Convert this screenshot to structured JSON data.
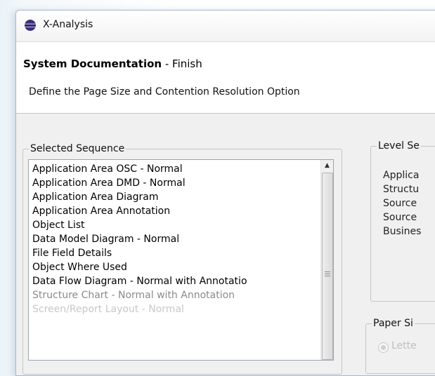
{
  "window": {
    "title": "X-Analysis"
  },
  "wizard": {
    "title_bold": "System Documentation",
    "title_rest": " - Finish",
    "description": "Define the Page Size and Contention Resolution Option"
  },
  "selected_sequence": {
    "label": "Selected Sequence",
    "items": [
      "Application Area OSC - Normal",
      "Application Area DMD - Normal",
      "Application Area Diagram",
      "Application Area Annotation",
      "Object List",
      "Data Model Diagram - Normal",
      "File Field Details",
      "Object Where Used",
      "Data Flow Diagram - Normal with Annotatio",
      "Structure Chart - Normal with Annotation",
      "Screen/Report Layout - Normal"
    ]
  },
  "level_settings": {
    "label": "Level Se",
    "items": [
      "Applica",
      "Structu",
      "Source",
      "Source",
      "Busines"
    ]
  },
  "paper_size": {
    "label": "Paper Si",
    "option": "Lette"
  },
  "icons": {
    "app": "eclipse-icon",
    "scroll_up": "scroll-up-arrow-icon",
    "scroll_grip": "scroll-grip-icon"
  },
  "colors": {
    "list_border": "#9aa4ae",
    "group_border": "#c5c5c5",
    "disabled_text": "#c0c0c0"
  }
}
